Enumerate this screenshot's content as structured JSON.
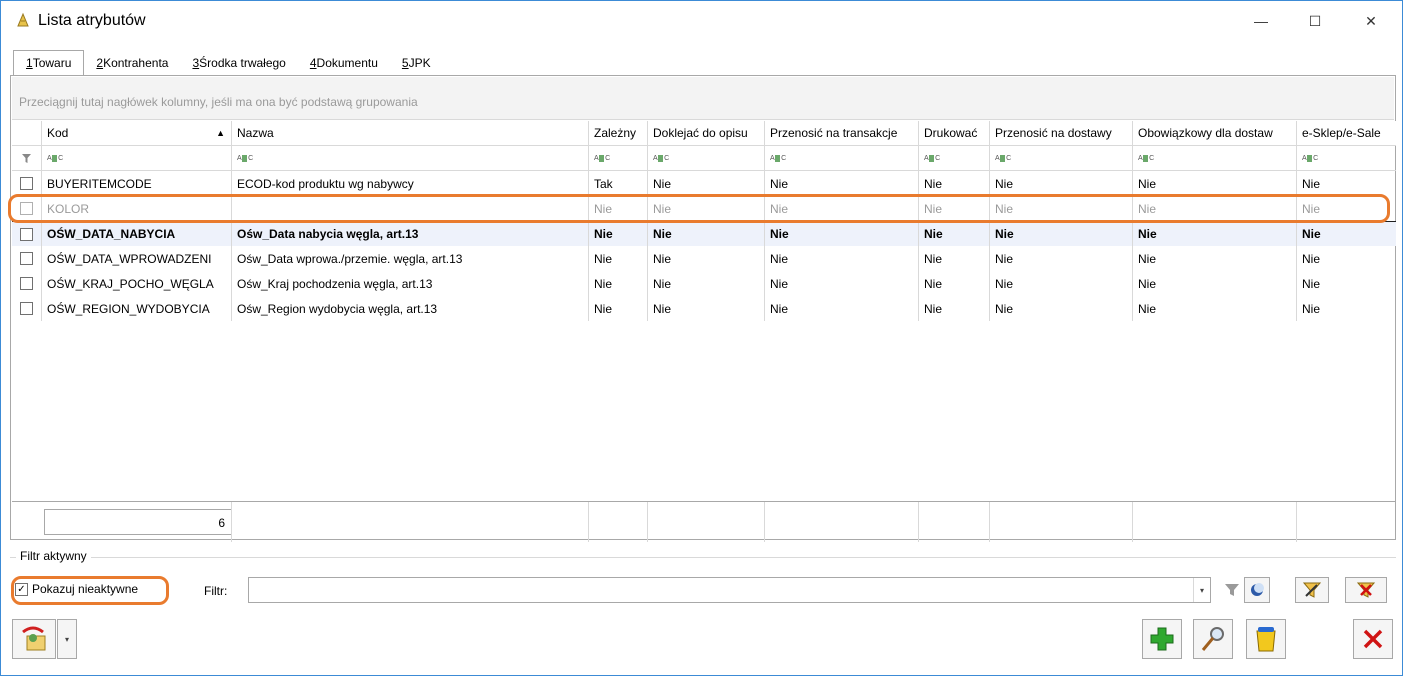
{
  "window": {
    "title": "Lista atrybutów",
    "minimize": "—",
    "maximize": "☐",
    "close": "✕"
  },
  "tabs": [
    {
      "key": "1",
      "label": "Towaru"
    },
    {
      "key": "2",
      "label": "Kontrahenta"
    },
    {
      "key": "3",
      "label": "Środka trwałego"
    },
    {
      "key": "4",
      "label": "Dokumentu"
    },
    {
      "key": "5",
      "label": "JPK"
    }
  ],
  "grid": {
    "group_hint": "Przeciągnij tutaj nagłówek kolumny, jeśli ma ona być podstawą grupowania",
    "columns": [
      "Kod",
      "Nazwa",
      "Zależny",
      "Doklejać do opisu",
      "Przenosić na transakcje",
      "Drukować",
      "Przenosić na dostawy",
      "Obowiązkowy dla dostaw",
      "e-Sklep/e-Sale"
    ],
    "sort_indicator": "▲",
    "rows": [
      {
        "kod": "BUYERITEMCODE",
        "nazwa": "ECOD-kod produktu wg nabywcy",
        "zalezny": "Tak",
        "doklejac": "Nie",
        "transakcje": "Nie",
        "drukowac": "Nie",
        "dostawy": "Nie",
        "obowiazkowy": "Nie",
        "esklep": "Nie"
      },
      {
        "kod": "KOLOR",
        "nazwa": "",
        "zalezny": "Nie",
        "doklejac": "Nie",
        "transakcje": "Nie",
        "drukowac": "Nie",
        "dostawy": "Nie",
        "obowiazkowy": "Nie",
        "esklep": "Nie"
      },
      {
        "kod": "OŚW_DATA_NABYCIA",
        "nazwa": "Ośw_Data nabycia węgla, art.13",
        "zalezny": "Nie",
        "doklejac": "Nie",
        "transakcje": "Nie",
        "drukowac": "Nie",
        "dostawy": "Nie",
        "obowiazkowy": "Nie",
        "esklep": "Nie"
      },
      {
        "kod": "OŚW_DATA_WPROWADZENI",
        "nazwa": "Ośw_Data wprowa./przemie. węgla, art.13",
        "zalezny": "Nie",
        "doklejac": "Nie",
        "transakcje": "Nie",
        "drukowac": "Nie",
        "dostawy": "Nie",
        "obowiazkowy": "Nie",
        "esklep": "Nie"
      },
      {
        "kod": "OŚW_KRAJ_POCHO_WĘGLA",
        "nazwa": "Ośw_Kraj pochodzenia węgla, art.13",
        "zalezny": "Nie",
        "doklejac": "Nie",
        "transakcje": "Nie",
        "drukowac": "Nie",
        "dostawy": "Nie",
        "obowiazkowy": "Nie",
        "esklep": "Nie"
      },
      {
        "kod": "OŚW_REGION_WYDOBYCIA",
        "nazwa": "Ośw_Region wydobycia węgla, art.13",
        "zalezny": "Nie",
        "doklejac": "Nie",
        "transakcje": "Nie",
        "drukowac": "Nie",
        "dostawy": "Nie",
        "obowiazkowy": "Nie",
        "esklep": "Nie"
      }
    ],
    "count": "6"
  },
  "filter": {
    "group_title": "Filtr aktywny",
    "show_inactive_label": "Pokazuj nieaktywne",
    "show_inactive_checked": "✓",
    "filter_label": "Filtr:",
    "filter_value": "",
    "dropdown": "▾"
  }
}
